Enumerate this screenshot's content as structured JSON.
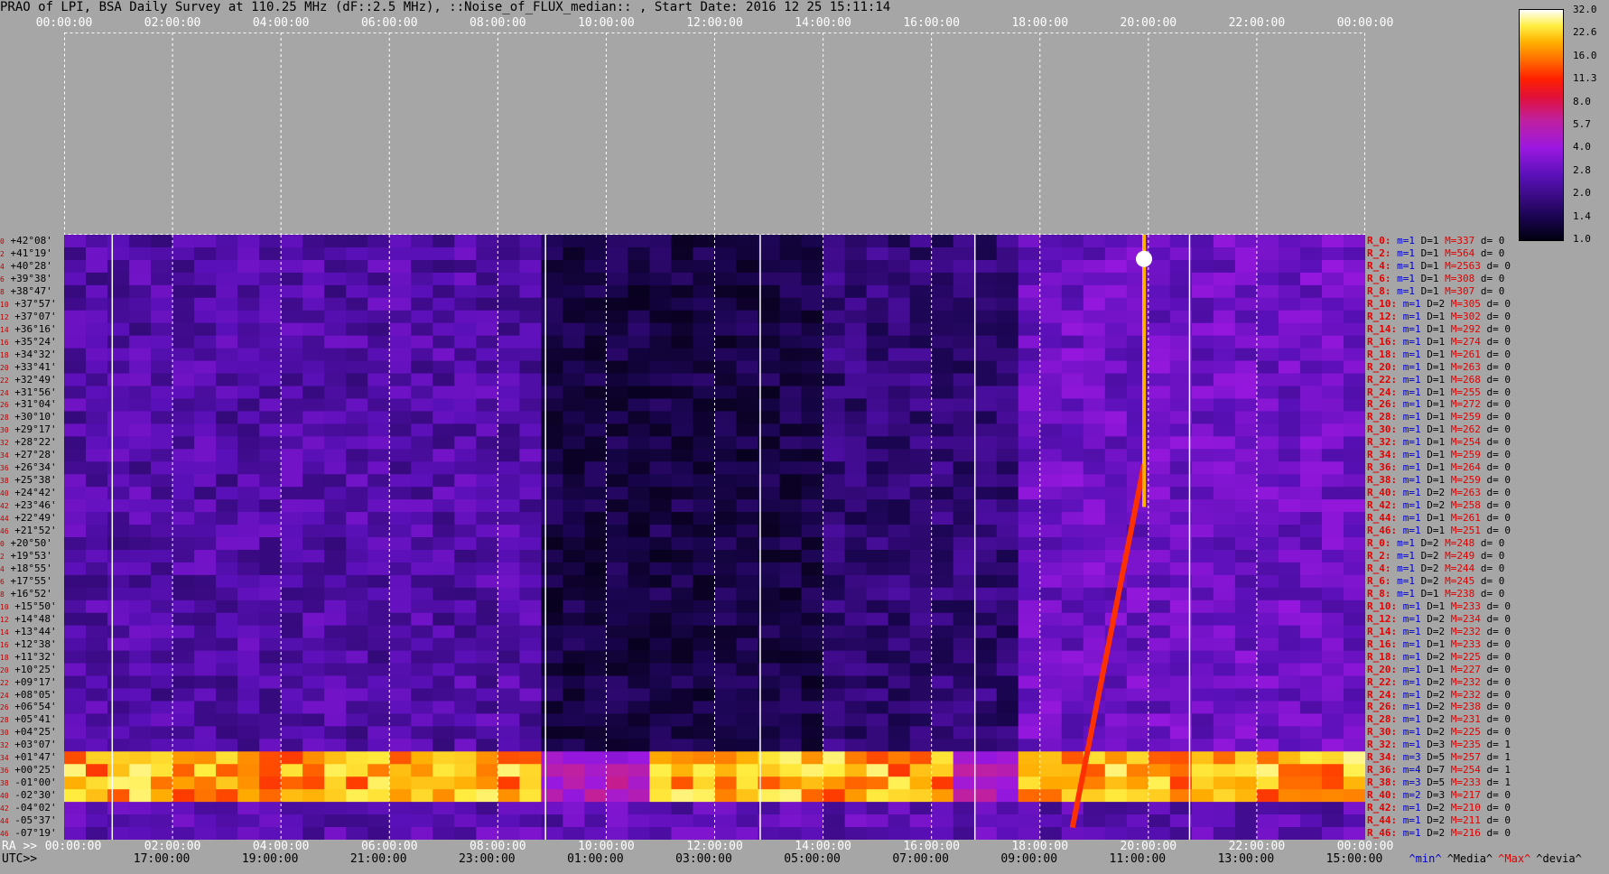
{
  "title": "PRAO of LPI, BSA Daily Survey at 110.25 MHz (dF::2.5 MHz), ::Noise_of_FLUX_median:: , Start Date: 2016 12 25 15:11:14",
  "top_axis": [
    "00:00:00",
    "02:00:00",
    "04:00:00",
    "06:00:00",
    "08:00:00",
    "10:00:00",
    "12:00:00",
    "14:00:00",
    "16:00:00",
    "18:00:00",
    "20:00:00",
    "22:00:00",
    "00:00:00"
  ],
  "bottom_ra_prefix": "RA >>",
  "bottom_ra": [
    "00:00:00",
    "02:00:00",
    "04:00:00",
    "06:00:00",
    "08:00:00",
    "10:00:00",
    "12:00:00",
    "14:00:00",
    "16:00:00",
    "18:00:00",
    "20:00:00",
    "22:00:00",
    "00:00:00"
  ],
  "bottom_utc_prefix": "UTC>>",
  "bottom_utc": [
    "17:00:00",
    "19:00:00",
    "21:00:00",
    "23:00:00",
    "01:00:00",
    "03:00:00",
    "05:00:00",
    "07:00:00",
    "09:00:00",
    "11:00:00",
    "13:00:00",
    "15:00:00"
  ],
  "declinations": [
    "+42°08'",
    "+41°19'",
    "+40°28'",
    "+39°38'",
    "+38°47'",
    "+37°57'",
    "+37°07'",
    "+36°16'",
    "+35°24'",
    "+34°32'",
    "+33°41'",
    "+32°49'",
    "+31°56'",
    "+31°04'",
    "+30°10'",
    "+29°17'",
    "+28°22'",
    "+27°28'",
    "+26°34'",
    "+25°38'",
    "+24°42'",
    "+23°46'",
    "+22°49'",
    "+21°52'",
    "+20°50'",
    "+19°53'",
    "+18°55'",
    "+17°55'",
    "+16°52'",
    "+15°50'",
    "+14°48'",
    "+13°44'",
    "+12°38'",
    "+11°32'",
    "+10°25'",
    "+09°17'",
    "+08°05'",
    "+06°54'",
    "+05°41'",
    "+04°25'",
    "+03°07'",
    "+01°47'",
    "+00°25'",
    "-01°00'",
    "-02°30'",
    "-04°02'",
    "-05°37'",
    "-07°19'"
  ],
  "row_index": [
    "0",
    "2",
    "4",
    "6",
    "8",
    "10",
    "12",
    "14",
    "16",
    "18",
    "20",
    "22",
    "24",
    "26",
    "28",
    "30",
    "32",
    "34",
    "36",
    "38",
    "40",
    "42",
    "44",
    "46",
    "0",
    "2",
    "4",
    "6",
    "8",
    "10",
    "12",
    "14",
    "16",
    "18",
    "20",
    "22",
    "24",
    "26",
    "28",
    "30",
    "32",
    "34",
    "36",
    "38",
    "40",
    "42",
    "44",
    "46"
  ],
  "row_stats": [
    {
      "r": "R_0:",
      "m": "m=1",
      "d": "D=1",
      "mx": "M=337",
      "dv": "d= 0"
    },
    {
      "r": "R_2:",
      "m": "m=1",
      "d": "D=1",
      "mx": "M=564",
      "dv": "d= 0"
    },
    {
      "r": "R_4:",
      "m": "m=1",
      "d": "D=1",
      "mx": "M=2563",
      "dv": "d= 0"
    },
    {
      "r": "R_6:",
      "m": "m=1",
      "d": "D=1",
      "mx": "M=308",
      "dv": "d= 0"
    },
    {
      "r": "R_8:",
      "m": "m=1",
      "d": "D=1",
      "mx": "M=307",
      "dv": "d= 0"
    },
    {
      "r": "R_10:",
      "m": "m=1",
      "d": "D=2",
      "mx": "M=305",
      "dv": "d= 0"
    },
    {
      "r": "R_12:",
      "m": "m=1",
      "d": "D=1",
      "mx": "M=302",
      "dv": "d= 0"
    },
    {
      "r": "R_14:",
      "m": "m=1",
      "d": "D=1",
      "mx": "M=292",
      "dv": "d= 0"
    },
    {
      "r": "R_16:",
      "m": "m=1",
      "d": "D=1",
      "mx": "M=274",
      "dv": "d= 0"
    },
    {
      "r": "R_18:",
      "m": "m=1",
      "d": "D=1",
      "mx": "M=261",
      "dv": "d= 0"
    },
    {
      "r": "R_20:",
      "m": "m=1",
      "d": "D=1",
      "mx": "M=263",
      "dv": "d= 0"
    },
    {
      "r": "R_22:",
      "m": "m=1",
      "d": "D=1",
      "mx": "M=268",
      "dv": "d= 0"
    },
    {
      "r": "R_24:",
      "m": "m=1",
      "d": "D=1",
      "mx": "M=255",
      "dv": "d= 0"
    },
    {
      "r": "R_26:",
      "m": "m=1",
      "d": "D=1",
      "mx": "M=272",
      "dv": "d= 0"
    },
    {
      "r": "R_28:",
      "m": "m=1",
      "d": "D=1",
      "mx": "M=259",
      "dv": "d= 0"
    },
    {
      "r": "R_30:",
      "m": "m=1",
      "d": "D=1",
      "mx": "M=262",
      "dv": "d= 0"
    },
    {
      "r": "R_32:",
      "m": "m=1",
      "d": "D=1",
      "mx": "M=254",
      "dv": "d= 0"
    },
    {
      "r": "R_34:",
      "m": "m=1",
      "d": "D=1",
      "mx": "M=259",
      "dv": "d= 0"
    },
    {
      "r": "R_36:",
      "m": "m=1",
      "d": "D=1",
      "mx": "M=264",
      "dv": "d= 0"
    },
    {
      "r": "R_38:",
      "m": "m=1",
      "d": "D=1",
      "mx": "M=259",
      "dv": "d= 0"
    },
    {
      "r": "R_40:",
      "m": "m=1",
      "d": "D=2",
      "mx": "M=263",
      "dv": "d= 0"
    },
    {
      "r": "R_42:",
      "m": "m=1",
      "d": "D=2",
      "mx": "M=258",
      "dv": "d= 0"
    },
    {
      "r": "R_44:",
      "m": "m=1",
      "d": "D=1",
      "mx": "M=261",
      "dv": "d= 0"
    },
    {
      "r": "R_46:",
      "m": "m=1",
      "d": "D=1",
      "mx": "M=251",
      "dv": "d= 0"
    },
    {
      "r": "R_0:",
      "m": "m=1",
      "d": "D=2",
      "mx": "M=248",
      "dv": "d= 0"
    },
    {
      "r": "R_2:",
      "m": "m=1",
      "d": "D=2",
      "mx": "M=249",
      "dv": "d= 0"
    },
    {
      "r": "R_4:",
      "m": "m=1",
      "d": "D=2",
      "mx": "M=244",
      "dv": "d= 0"
    },
    {
      "r": "R_6:",
      "m": "m=1",
      "d": "D=2",
      "mx": "M=245",
      "dv": "d= 0"
    },
    {
      "r": "R_8:",
      "m": "m=1",
      "d": "D=1",
      "mx": "M=238",
      "dv": "d= 0"
    },
    {
      "r": "R_10:",
      "m": "m=1",
      "d": "D=1",
      "mx": "M=233",
      "dv": "d= 0"
    },
    {
      "r": "R_12:",
      "m": "m=1",
      "d": "D=2",
      "mx": "M=234",
      "dv": "d= 0"
    },
    {
      "r": "R_14:",
      "m": "m=1",
      "d": "D=2",
      "mx": "M=232",
      "dv": "d= 0"
    },
    {
      "r": "R_16:",
      "m": "m=1",
      "d": "D=1",
      "mx": "M=233",
      "dv": "d= 0"
    },
    {
      "r": "R_18:",
      "m": "m=1",
      "d": "D=2",
      "mx": "M=225",
      "dv": "d= 0"
    },
    {
      "r": "R_20:",
      "m": "m=1",
      "d": "D=1",
      "mx": "M=227",
      "dv": "d= 0"
    },
    {
      "r": "R_22:",
      "m": "m=1",
      "d": "D=2",
      "mx": "M=232",
      "dv": "d= 0"
    },
    {
      "r": "R_24:",
      "m": "m=1",
      "d": "D=2",
      "mx": "M=232",
      "dv": "d= 0"
    },
    {
      "r": "R_26:",
      "m": "m=1",
      "d": "D=2",
      "mx": "M=238",
      "dv": "d= 0"
    },
    {
      "r": "R_28:",
      "m": "m=1",
      "d": "D=2",
      "mx": "M=231",
      "dv": "d= 0"
    },
    {
      "r": "R_30:",
      "m": "m=1",
      "d": "D=2",
      "mx": "M=225",
      "dv": "d= 0"
    },
    {
      "r": "R_32:",
      "m": "m=1",
      "d": "D=3",
      "mx": "M=235",
      "dv": "d= 1"
    },
    {
      "r": "R_34:",
      "m": "m=3",
      "d": "D=5",
      "mx": "M=257",
      "dv": "d= 1"
    },
    {
      "r": "R_36:",
      "m": "m=4",
      "d": "D=7",
      "mx": "M=254",
      "dv": "d= 1"
    },
    {
      "r": "R_38:",
      "m": "m=3",
      "d": "D=5",
      "mx": "M=233",
      "dv": "d= 1"
    },
    {
      "r": "R_40:",
      "m": "m=2",
      "d": "D=3",
      "mx": "M=217",
      "dv": "d= 0"
    },
    {
      "r": "R_42:",
      "m": "m=1",
      "d": "D=2",
      "mx": "M=210",
      "dv": "d= 0"
    },
    {
      "r": "R_44:",
      "m": "m=1",
      "d": "D=2",
      "mx": "M=211",
      "dv": "d= 0"
    },
    {
      "r": "R_46:",
      "m": "m=1",
      "d": "D=2",
      "mx": "M=216",
      "dv": "d= 0"
    }
  ],
  "colorbar_labels": [
    "32.0",
    "22.6",
    "16.0",
    "11.3",
    "8.0",
    "5.7",
    "4.0",
    "2.8",
    "2.0",
    "1.4",
    "1.0"
  ],
  "legend": {
    "min": "^min^",
    "median": "^Media^",
    "max": "^Max^",
    "dev": "^devia^"
  },
  "colors": {
    "background": "#a6a6a6",
    "min": "#0000cc",
    "median": "#000000",
    "max": "#e00000",
    "dev": "#000000"
  }
}
